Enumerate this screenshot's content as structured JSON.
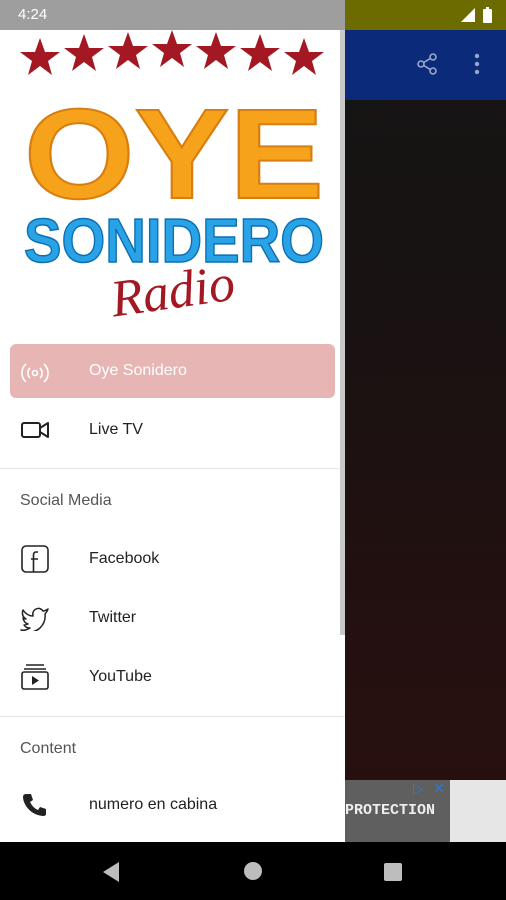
{
  "status_bar": {
    "time": "4:24",
    "signal_icon": "signal-icon",
    "battery_icon": "battery-icon"
  },
  "toolbar": {
    "share_icon": "share-icon",
    "more_icon": "more-vert-icon"
  },
  "logo": {
    "line1": "OYE",
    "line2": "SONIDERO",
    "line3": "Radio"
  },
  "drawer": {
    "items": [
      {
        "label": "Oye Sonidero",
        "icon": "radio-broadcast-icon",
        "active": true
      },
      {
        "label": "Live TV",
        "icon": "video-camera-icon"
      }
    ],
    "sections": [
      {
        "title": "Social Media",
        "items": [
          {
            "label": "Facebook",
            "icon": "facebook-icon"
          },
          {
            "label": "Twitter",
            "icon": "twitter-icon"
          },
          {
            "label": "YouTube",
            "icon": "youtube-icon"
          }
        ]
      },
      {
        "title": "Content",
        "items": [
          {
            "label": "numero en cabina",
            "icon": "phone-icon"
          }
        ]
      }
    ]
  },
  "ad": {
    "text": "PROTECTION"
  },
  "colors": {
    "active_bg": "#e8b5b5",
    "toolbar": "#0c2a7a",
    "status_bar": "#6b6b00",
    "logo_orange": "#f7a21b",
    "logo_blue": "#2aa3e6",
    "logo_red": "#a31822"
  }
}
